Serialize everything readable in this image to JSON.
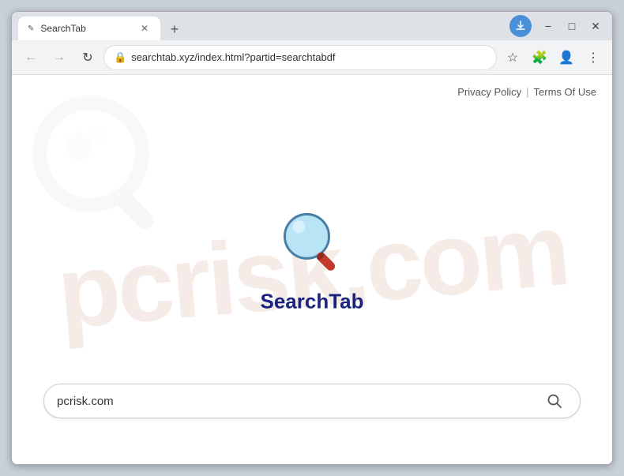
{
  "window": {
    "title": "SearchTab",
    "minimize_label": "−",
    "maximize_label": "□",
    "close_label": "✕"
  },
  "tab": {
    "favicon": "✎",
    "label": "SearchTab",
    "close": "✕"
  },
  "new_tab_button": "+",
  "toolbar": {
    "back_arrow": "←",
    "forward_arrow": "→",
    "refresh": "↻",
    "url": "searchtab.xyz/index.html?partid=searchtabdf",
    "lock_icon": "🔒",
    "bookmark_icon": "☆",
    "extension_icon": "🧩",
    "profile_icon": "👤",
    "menu_icon": "⋮"
  },
  "page": {
    "top_links": {
      "privacy": "Privacy Policy",
      "separator": "|",
      "terms": "Terms Of Use"
    },
    "brand": "SearchTab",
    "watermark": "pcrisk.com",
    "search": {
      "placeholder": "pcrisk.com",
      "value": "pcrisk.com",
      "button_icon": "🔍"
    }
  }
}
